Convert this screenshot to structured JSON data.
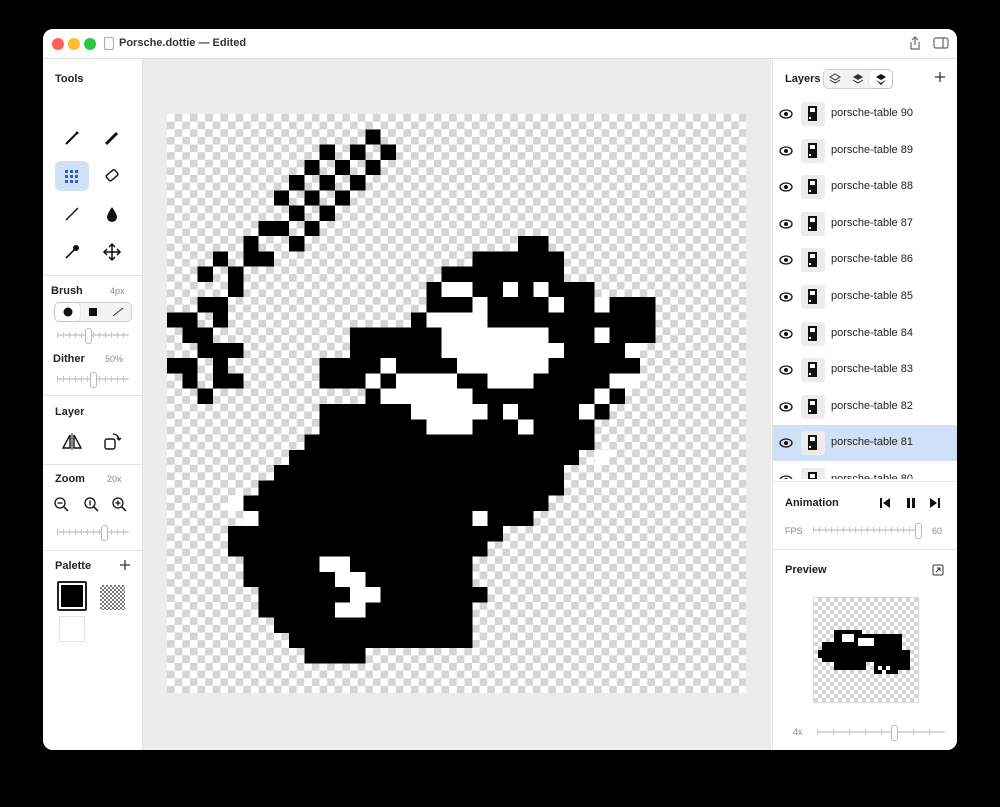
{
  "window": {
    "title": "Porsche.dottie — Edited"
  },
  "tools": {
    "title": "Tools",
    "items": [
      "pencil",
      "pen",
      "dither-grid",
      "eraser",
      "line",
      "fill-drop",
      "eyedropper",
      "move"
    ]
  },
  "brush": {
    "label": "Brush",
    "value": "4px",
    "size": 0.35
  },
  "dither": {
    "label": "Dither",
    "value": "50%",
    "level": 0.5
  },
  "layer_tools": {
    "title": "Layer"
  },
  "zoom": {
    "label": "Zoom",
    "value": "20x",
    "level": 0.65
  },
  "palette": {
    "title": "Palette",
    "primary": "#000000",
    "secondary": "#ffffff"
  },
  "layers": {
    "title": "Layers",
    "items": [
      {
        "name": "porsche-table 90",
        "selected": false
      },
      {
        "name": "porsche-table 89",
        "selected": false
      },
      {
        "name": "porsche-table 88",
        "selected": false
      },
      {
        "name": "porsche-table 87",
        "selected": false
      },
      {
        "name": "porsche-table 86",
        "selected": false
      },
      {
        "name": "porsche-table 85",
        "selected": false
      },
      {
        "name": "porsche-table 84",
        "selected": false
      },
      {
        "name": "porsche-table 83",
        "selected": false
      },
      {
        "name": "porsche-table 82",
        "selected": false
      },
      {
        "name": "porsche-table 81",
        "selected": true
      },
      {
        "name": "porsche-table 80",
        "selected": false
      }
    ]
  },
  "animation": {
    "title": "Animation",
    "fps_label": "FPS",
    "fps_value": "60",
    "fps_level": 1.0
  },
  "preview": {
    "title": "Preview",
    "scale_label": "4x",
    "scale_level": 0.6
  },
  "colors": {
    "accent": "#cfe0f7",
    "ink": "#000000"
  }
}
